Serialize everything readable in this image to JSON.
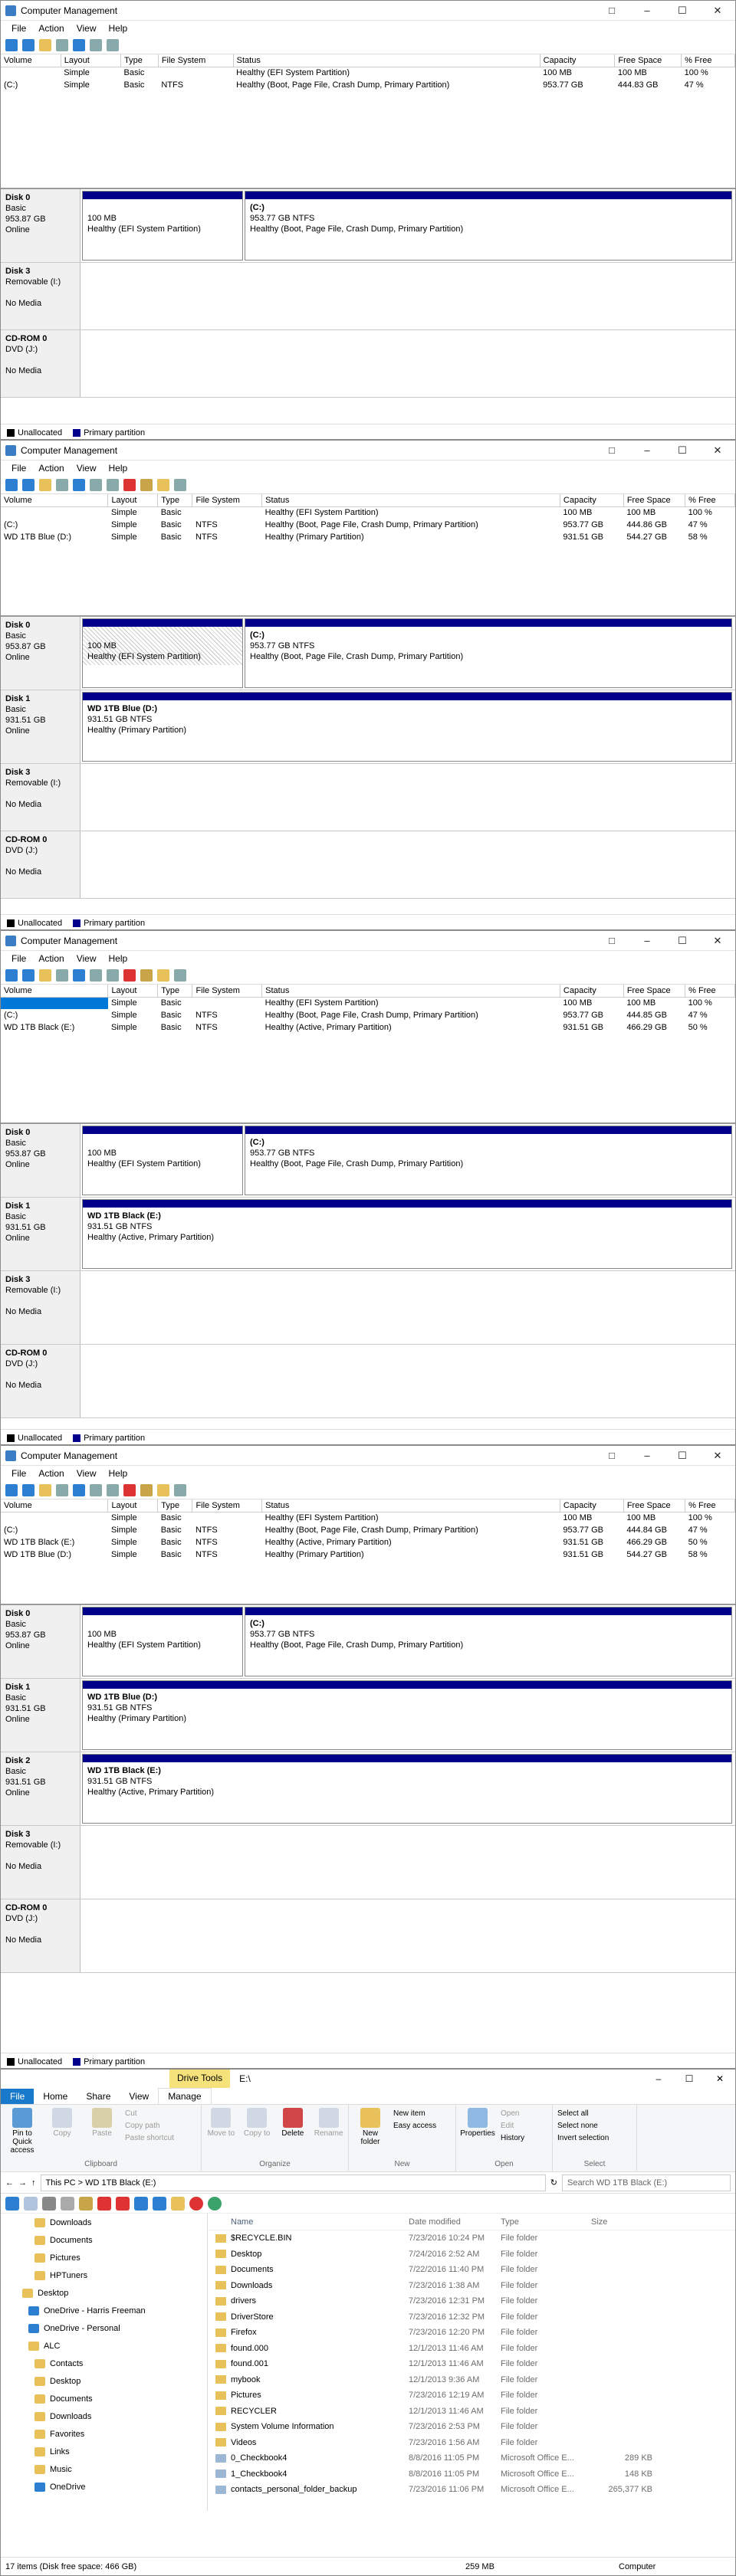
{
  "colors": {
    "primary_partition": "#00008b",
    "unallocated": "#000000",
    "selection": "#0078d7",
    "drive_tools": "#f6e27a"
  },
  "mmc": {
    "title": "Computer Management",
    "menu": [
      "File",
      "Action",
      "View",
      "Help"
    ],
    "columns": [
      "Volume",
      "Layout",
      "Type",
      "File System",
      "Status",
      "Capacity",
      "Free Space",
      "% Free"
    ],
    "legend": {
      "unallocated": "Unallocated",
      "primary": "Primary partition"
    }
  },
  "w1": {
    "volumes": [
      [
        "",
        "Simple",
        "Basic",
        "",
        "Healthy (EFI System Partition)",
        "100 MB",
        "100 MB",
        "100 %"
      ],
      [
        "(C:)",
        "Simple",
        "Basic",
        "NTFS",
        "Healthy (Boot, Page File, Crash Dump, Primary Partition)",
        "953.77 GB",
        "444.83 GB",
        "47 %"
      ]
    ],
    "disks": [
      {
        "name": "Disk 0",
        "l1": "Basic",
        "l2": "953.87 GB",
        "l3": "Online",
        "parts": [
          {
            "n": "",
            "s": "100 MB",
            "h": "Healthy (EFI System Partition)"
          },
          {
            "n": "(C:)",
            "s": "953.77 GB NTFS",
            "h": "Healthy (Boot, Page File, Crash Dump, Primary Partition)"
          }
        ]
      },
      {
        "name": "Disk 3",
        "l1": "Removable (I:)",
        "l2": "",
        "l3": "No Media",
        "parts": []
      },
      {
        "name": "CD-ROM 0",
        "l1": "DVD (J:)",
        "l2": "",
        "l3": "No Media",
        "parts": []
      }
    ]
  },
  "w2": {
    "volumes": [
      [
        "",
        "Simple",
        "Basic",
        "",
        "Healthy (EFI System Partition)",
        "100 MB",
        "100 MB",
        "100 %"
      ],
      [
        "(C:)",
        "Simple",
        "Basic",
        "NTFS",
        "Healthy (Boot, Page File, Crash Dump, Primary Partition)",
        "953.77 GB",
        "444.86 GB",
        "47 %"
      ],
      [
        "WD 1TB Blue (D:)",
        "Simple",
        "Basic",
        "NTFS",
        "Healthy (Primary Partition)",
        "931.51 GB",
        "544.27 GB",
        "58 %"
      ]
    ],
    "disks": [
      {
        "name": "Disk 0",
        "l1": "Basic",
        "l2": "953.87 GB",
        "l3": "Online",
        "parts": [
          {
            "n": "",
            "s": "100 MB",
            "h": "Healthy (EFI System Partition)"
          },
          {
            "n": "(C:)",
            "s": "953.77 GB NTFS",
            "h": "Healthy (Boot, Page File, Crash Dump, Primary Partition)"
          }
        ]
      },
      {
        "name": "Disk 1",
        "l1": "Basic",
        "l2": "931.51 GB",
        "l3": "Online",
        "parts": [
          {
            "n": "WD 1TB Blue  (D:)",
            "s": "931.51 GB NTFS",
            "h": "Healthy (Primary Partition)"
          }
        ]
      },
      {
        "name": "Disk 3",
        "l1": "Removable (I:)",
        "l2": "",
        "l3": "No Media",
        "parts": []
      },
      {
        "name": "CD-ROM 0",
        "l1": "DVD (J:)",
        "l2": "",
        "l3": "No Media",
        "parts": []
      }
    ]
  },
  "w3": {
    "volumes": [
      [
        "",
        "Simple",
        "Basic",
        "",
        "Healthy (EFI System Partition)",
        "100 MB",
        "100 MB",
        "100 %"
      ],
      [
        "(C:)",
        "Simple",
        "Basic",
        "NTFS",
        "Healthy (Boot, Page File, Crash Dump, Primary Partition)",
        "953.77 GB",
        "444.85 GB",
        "47 %"
      ],
      [
        "WD 1TB Black (E:)",
        "Simple",
        "Basic",
        "NTFS",
        "Healthy (Active, Primary Partition)",
        "931.51 GB",
        "466.29 GB",
        "50 %"
      ]
    ],
    "disks": [
      {
        "name": "Disk 0",
        "l1": "Basic",
        "l2": "953.87 GB",
        "l3": "Online",
        "parts": [
          {
            "n": "",
            "s": "100 MB",
            "h": "Healthy (EFI System Partition)"
          },
          {
            "n": "(C:)",
            "s": "953.77 GB NTFS",
            "h": "Healthy (Boot, Page File, Crash Dump, Primary Partition)"
          }
        ]
      },
      {
        "name": "Disk 1",
        "l1": "Basic",
        "l2": "931.51 GB",
        "l3": "Online",
        "parts": [
          {
            "n": "WD 1TB Black  (E:)",
            "s": "931.51 GB NTFS",
            "h": "Healthy (Active, Primary Partition)"
          }
        ]
      },
      {
        "name": "Disk 3",
        "l1": "Removable (I:)",
        "l2": "",
        "l3": "No Media",
        "parts": []
      },
      {
        "name": "CD-ROM 0",
        "l1": "DVD (J:)",
        "l2": "",
        "l3": "No Media",
        "parts": []
      }
    ]
  },
  "w4": {
    "volumes": [
      [
        "",
        "Simple",
        "Basic",
        "",
        "Healthy (EFI System Partition)",
        "100 MB",
        "100 MB",
        "100 %"
      ],
      [
        "(C:)",
        "Simple",
        "Basic",
        "NTFS",
        "Healthy (Boot, Page File, Crash Dump, Primary Partition)",
        "953.77 GB",
        "444.84 GB",
        "47 %"
      ],
      [
        "WD 1TB Black (E:)",
        "Simple",
        "Basic",
        "NTFS",
        "Healthy (Active, Primary Partition)",
        "931.51 GB",
        "466.29 GB",
        "50 %"
      ],
      [
        "WD 1TB Blue (D:)",
        "Simple",
        "Basic",
        "NTFS",
        "Healthy (Primary Partition)",
        "931.51 GB",
        "544.27 GB",
        "58 %"
      ]
    ],
    "disks": [
      {
        "name": "Disk 0",
        "l1": "Basic",
        "l2": "953.87 GB",
        "l3": "Online",
        "parts": [
          {
            "n": "",
            "s": "100 MB",
            "h": "Healthy (EFI System Partition)"
          },
          {
            "n": "(C:)",
            "s": "953.77 GB NTFS",
            "h": "Healthy (Boot, Page File, Crash Dump, Primary Partition)"
          }
        ]
      },
      {
        "name": "Disk 1",
        "l1": "Basic",
        "l2": "931.51 GB",
        "l3": "Online",
        "parts": [
          {
            "n": "WD 1TB Blue  (D:)",
            "s": "931.51 GB NTFS",
            "h": "Healthy (Primary Partition)"
          }
        ]
      },
      {
        "name": "Disk 2",
        "l1": "Basic",
        "l2": "931.51 GB",
        "l3": "Online",
        "parts": [
          {
            "n": "WD 1TB Black  (E:)",
            "s": "931.51 GB NTFS",
            "h": "Healthy (Active, Primary Partition)"
          }
        ]
      },
      {
        "name": "Disk 3",
        "l1": "Removable (I:)",
        "l2": "",
        "l3": "No Media",
        "parts": []
      },
      {
        "name": "CD-ROM 0",
        "l1": "DVD (J:)",
        "l2": "",
        "l3": "No Media",
        "parts": []
      }
    ]
  },
  "explorer": {
    "drive_tools": "Drive Tools",
    "title": "E:\\",
    "tabs": [
      "File",
      "Home",
      "Share",
      "View",
      "Manage"
    ],
    "ribbon": {
      "clipboard": {
        "name": "Clipboard",
        "pin": "Pin to Quick access",
        "copy": "Copy",
        "paste": "Paste",
        "cut": "Cut",
        "copy_path": "Copy path",
        "paste_shortcut": "Paste shortcut"
      },
      "organize": {
        "name": "Organize",
        "move_to": "Move to",
        "copy_to": "Copy to",
        "delete": "Delete",
        "rename": "Rename"
      },
      "new": {
        "name": "New",
        "new_folder": "New folder",
        "new_item": "New item",
        "easy_access": "Easy access"
      },
      "open": {
        "name": "Open",
        "properties": "Properties",
        "open": "Open",
        "edit": "Edit",
        "history": "History"
      },
      "select": {
        "name": "Select",
        "select_all": "Select all",
        "select_none": "Select none",
        "invert": "Invert selection"
      }
    },
    "address": "This PC  >  WD 1TB Black (E:)",
    "search_placeholder": "Search WD 1TB Black (E:)",
    "nav": [
      "Downloads",
      "Documents",
      "Pictures",
      "HPTuners",
      "Desktop",
      "OneDrive - Harris Freeman",
      "OneDrive - Personal",
      "ALC",
      "Contacts",
      "Desktop",
      "Documents",
      "Downloads",
      "Favorites",
      "Links",
      "Music",
      "OneDrive"
    ],
    "columns": [
      "Name",
      "Date modified",
      "Type",
      "Size"
    ],
    "files": [
      [
        "$RECYCLE.BIN",
        "7/23/2016 10:24 PM",
        "File folder",
        ""
      ],
      [
        "Desktop",
        "7/24/2016 2:52 AM",
        "File folder",
        ""
      ],
      [
        "Documents",
        "7/22/2016 11:40 PM",
        "File folder",
        ""
      ],
      [
        "Downloads",
        "7/23/2016 1:38 AM",
        "File folder",
        ""
      ],
      [
        "drivers",
        "7/23/2016 12:31 PM",
        "File folder",
        ""
      ],
      [
        "DriverStore",
        "7/23/2016 12:32 PM",
        "File folder",
        ""
      ],
      [
        "Firefox",
        "7/23/2016 12:20 PM",
        "File folder",
        ""
      ],
      [
        "found.000",
        "12/1/2013 11:46 AM",
        "File folder",
        ""
      ],
      [
        "found.001",
        "12/1/2013 11:46 AM",
        "File folder",
        ""
      ],
      [
        "mybook",
        "12/1/2013 9:36 AM",
        "File folder",
        ""
      ],
      [
        "Pictures",
        "7/23/2016 12:19 AM",
        "File folder",
        ""
      ],
      [
        "RECYCLER",
        "12/1/2013 11:46 AM",
        "File folder",
        ""
      ],
      [
        "System Volume Information",
        "7/23/2016 2:53 PM",
        "File folder",
        ""
      ],
      [
        "Videos",
        "7/23/2016 1:56 AM",
        "File folder",
        ""
      ],
      [
        "0_Checkbook4",
        "8/8/2016 11:05 PM",
        "Microsoft Office E...",
        "289 KB"
      ],
      [
        "1_Checkbook4",
        "8/8/2016 11:05 PM",
        "Microsoft Office E...",
        "148 KB"
      ],
      [
        "contacts_personal_folder_backup",
        "7/23/2016 11:06 PM",
        "Microsoft Office E...",
        "265,377 KB"
      ]
    ],
    "status_left": "17 items (Disk free space: 466 GB)",
    "status_mid": "259 MB",
    "status_right": "Computer"
  }
}
